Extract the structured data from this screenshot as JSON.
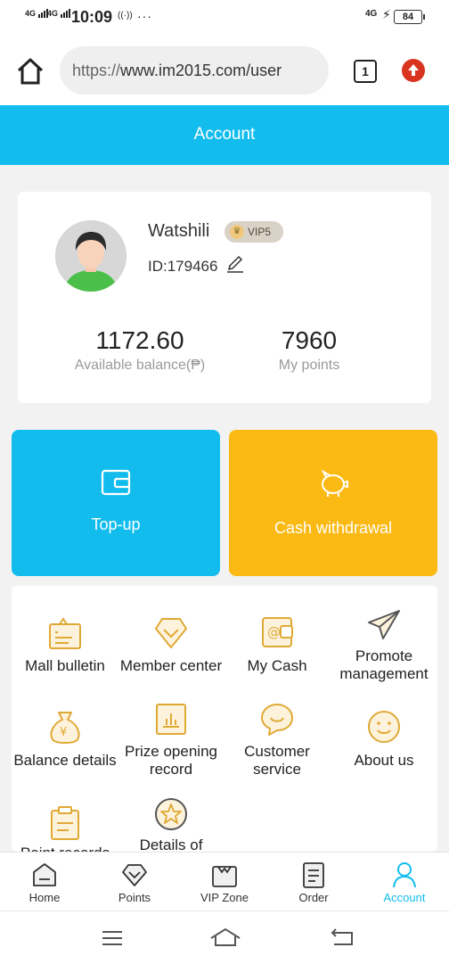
{
  "status_bar": {
    "signal_1": "4G",
    "signal_2": "4G",
    "time": "10:09",
    "more": "···",
    "network_right": "4G",
    "battery": "84"
  },
  "browser": {
    "url_scheme": "https://",
    "url_rest": "www.im2015.com/user",
    "tab_count": "1"
  },
  "header": {
    "title": "Account"
  },
  "profile": {
    "username": "Watshili",
    "vip": "VIP5",
    "id": "ID:179466",
    "balance_value": "1172.60",
    "balance_label": "Available balance(₱)",
    "points_value": "7960",
    "points_label": "My points"
  },
  "actions": {
    "topup": "Top-up",
    "withdraw": "Cash withdrawal"
  },
  "menu": [
    {
      "label": "Mall bulletin",
      "icon": "bulletin-icon"
    },
    {
      "label": "Member center",
      "icon": "diamond-icon"
    },
    {
      "label": "My Cash",
      "icon": "wallet-at-icon"
    },
    {
      "label": "Promote management",
      "icon": "paper-plane-icon"
    },
    {
      "label": "Balance details",
      "icon": "money-bag-icon"
    },
    {
      "label": "Prize opening record",
      "icon": "bar-chart-icon"
    },
    {
      "label": "Customer service",
      "icon": "chat-smile-icon"
    },
    {
      "label": "About us",
      "icon": "smile-icon"
    },
    {
      "label": "Point records",
      "icon": "clipboard-icon"
    },
    {
      "label": "Details of",
      "icon": "star-circle-icon"
    }
  ],
  "bottom_nav": [
    {
      "label": "Home"
    },
    {
      "label": "Points"
    },
    {
      "label": "VIP Zone"
    },
    {
      "label": "Order"
    },
    {
      "label": "Account"
    }
  ],
  "colors": {
    "accent": "#12bdee",
    "withdraw": "#fbb913",
    "icon": "#e0a935"
  }
}
